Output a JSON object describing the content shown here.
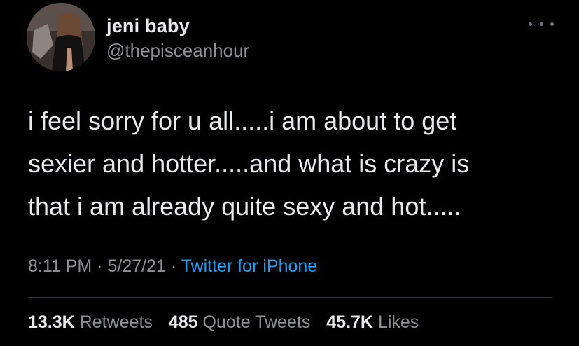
{
  "author": {
    "display_name": "jeni baby",
    "handle": "@thepisceanhour"
  },
  "tweet": {
    "lines": [
      "i feel sorry for u all.....i am about to get",
      "sexier and hotter.....and what is crazy is",
      "that i am already quite sexy and hot....."
    ],
    "time": "8:11 PM",
    "separator": " · ",
    "date": "5/27/21",
    "source": "Twitter for iPhone"
  },
  "stats": {
    "retweets_count": "13.3K",
    "retweets_label": "Retweets",
    "quotes_count": "485",
    "quotes_label": "Quote Tweets",
    "likes_count": "45.7K",
    "likes_label": "Likes"
  },
  "icons": {
    "more": "more-options-icon"
  },
  "colors": {
    "background": "#000000",
    "primary_text": "#e7e9ea",
    "secondary_text": "#8b9095",
    "link": "#1d9bf0",
    "divider": "#2f3336"
  }
}
